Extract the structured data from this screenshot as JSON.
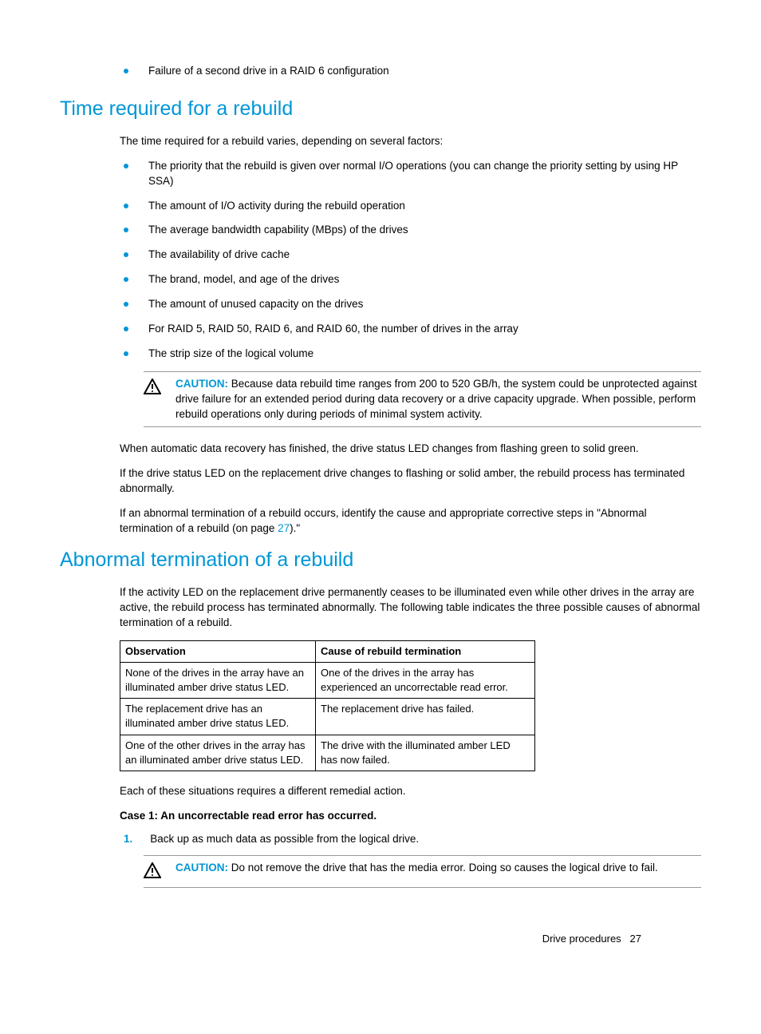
{
  "intro_bullet": "Failure of a second drive in a RAID 6 configuration",
  "section1": {
    "heading": "Time required for a rebuild",
    "intro": "The time required for a rebuild varies, depending on several factors:",
    "bullets": [
      "The priority that the rebuild is given over normal I/O operations (you can change the priority setting by using HP SSA)",
      "The amount of I/O activity during the rebuild operation",
      "The average bandwidth capability (MBps) of the drives",
      "The availability of drive cache",
      "The brand, model, and age of the drives",
      "The amount of unused capacity on the drives",
      "For RAID 5, RAID 50, RAID 6, and RAID 60, the number of drives in the array",
      "The strip size of the logical volume"
    ],
    "caution_label": "CAUTION:",
    "caution_text": "Because data rebuild time ranges from 200 to 520 GB/h, the system could be unprotected against drive failure for an extended period during data recovery or a drive capacity upgrade. When possible, perform rebuild operations only during periods of minimal system activity.",
    "p1": "When automatic data recovery has finished, the drive status LED changes from flashing green to solid green.",
    "p2": "If the drive status LED on the replacement drive changes to flashing or solid amber, the rebuild process has terminated abnormally.",
    "p3_pre": "If an abnormal termination of a rebuild occurs, identify the cause and appropriate corrective steps in \"Abnormal termination of a rebuild (on page ",
    "p3_link": "27",
    "p3_post": ").\""
  },
  "section2": {
    "heading": "Abnormal termination of a rebuild",
    "intro": "If the activity LED on the replacement drive permanently ceases to be illuminated even while other drives in the array are active, the rebuild process has terminated abnormally. The following table indicates the three possible causes of abnormal termination of a rebuild.",
    "table_headers": [
      "Observation",
      "Cause of rebuild termination"
    ],
    "table_rows": [
      [
        "None of the drives in the array have an illuminated amber drive status LED.",
        "One of the drives in the array has experienced an uncorrectable read error."
      ],
      [
        "The replacement drive has an illuminated amber drive status LED.",
        "The replacement drive has failed."
      ],
      [
        "One of the other drives in the array has an illuminated amber drive status LED.",
        "The drive with the illuminated amber LED has now failed."
      ]
    ],
    "p_after": "Each of these situations requires a different remedial action.",
    "case1_heading": "Case 1: An uncorrectable read error has occurred.",
    "step1_num": "1.",
    "step1_text": "Back up as much data as possible from the logical drive.",
    "caution2_label": "CAUTION:",
    "caution2_text": "Do not remove the drive that has the media error. Doing so causes the logical drive to fail."
  },
  "footer": {
    "section": "Drive procedures",
    "page": "27"
  }
}
